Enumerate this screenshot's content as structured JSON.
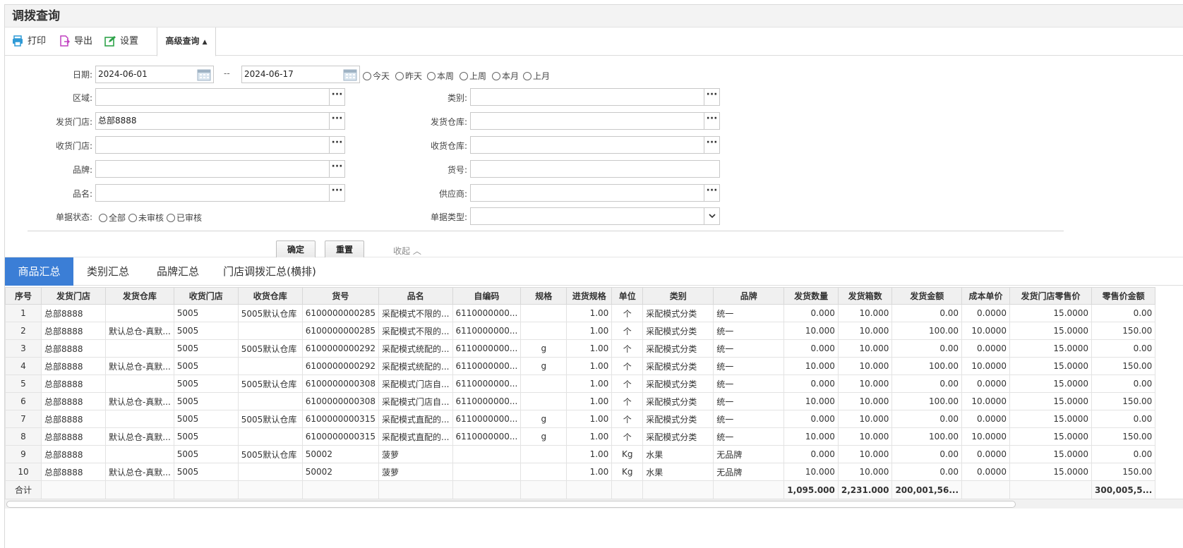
{
  "title": "调拨查询",
  "toolbar": {
    "print": "打印",
    "export": "导出",
    "settings": "设置",
    "advanced": "高级查询"
  },
  "query": {
    "date_label": "日期:",
    "date_from": "2024-06-01",
    "date_sep": "--",
    "date_to": "2024-06-17",
    "date_presets": [
      "今天",
      "昨天",
      "本周",
      "上周",
      "本月",
      "上月"
    ],
    "area_label": "区域:",
    "category_label": "类别:",
    "send_store_label": "发货门店:",
    "send_store_value": "总部8888",
    "send_wh_label": "发货仓库:",
    "recv_store_label": "收货门店:",
    "recv_wh_label": "收货仓库:",
    "brand_label": "品牌:",
    "item_no_label": "货号:",
    "name_label": "品名:",
    "supplier_label": "供应商:",
    "status_label": "单据状态:",
    "status_options": [
      "全部",
      "未审核",
      "已审核"
    ],
    "doc_type_label": "单据类型:",
    "confirm": "确定",
    "reset": "重置",
    "collapse": "收起"
  },
  "tabs": [
    "商品汇总",
    "类别汇总",
    "品牌汇总",
    "门店调拨汇总(横排)"
  ],
  "grid": {
    "headers": [
      "序号",
      "发货门店",
      "发货仓库",
      "收货门店",
      "收货仓库",
      "货号",
      "品名",
      "自编码",
      "规格",
      "进货规格",
      "单位",
      "类别",
      "品牌",
      "发货数量",
      "发货箱数",
      "发货金额",
      "成本单价",
      "发货门店零售价",
      "零售价金额"
    ],
    "rows": [
      [
        "1",
        "总部8888",
        "",
        "5005",
        "5005默认仓库",
        "6100000000285",
        "采配模式不限的...",
        "6110000000...",
        "",
        "1.00",
        "个",
        "采配模式分类",
        "统一",
        "0.000",
        "10.000",
        "0.00",
        "0.0000",
        "15.0000",
        "0.00"
      ],
      [
        "2",
        "总部8888",
        "默认总仓-真默...",
        "5005",
        "",
        "6100000000285",
        "采配模式不限的...",
        "6110000000...",
        "",
        "1.00",
        "个",
        "采配模式分类",
        "统一",
        "10.000",
        "10.000",
        "100.00",
        "10.0000",
        "15.0000",
        "150.00"
      ],
      [
        "3",
        "总部8888",
        "",
        "5005",
        "5005默认仓库",
        "6100000000292",
        "采配模式统配的...",
        "6110000000...",
        "g",
        "1.00",
        "个",
        "采配模式分类",
        "统一",
        "0.000",
        "10.000",
        "0.00",
        "0.0000",
        "15.0000",
        "0.00"
      ],
      [
        "4",
        "总部8888",
        "默认总仓-真默...",
        "5005",
        "",
        "6100000000292",
        "采配模式统配的...",
        "6110000000...",
        "g",
        "1.00",
        "个",
        "采配模式分类",
        "统一",
        "10.000",
        "10.000",
        "100.00",
        "10.0000",
        "15.0000",
        "150.00"
      ],
      [
        "5",
        "总部8888",
        "",
        "5005",
        "5005默认仓库",
        "6100000000308",
        "采配模式门店自...",
        "6110000000...",
        "",
        "1.00",
        "个",
        "采配模式分类",
        "统一",
        "0.000",
        "10.000",
        "0.00",
        "0.0000",
        "15.0000",
        "0.00"
      ],
      [
        "6",
        "总部8888",
        "默认总仓-真默...",
        "5005",
        "",
        "6100000000308",
        "采配模式门店自...",
        "6110000000...",
        "",
        "1.00",
        "个",
        "采配模式分类",
        "统一",
        "10.000",
        "10.000",
        "100.00",
        "10.0000",
        "15.0000",
        "150.00"
      ],
      [
        "7",
        "总部8888",
        "",
        "5005",
        "5005默认仓库",
        "6100000000315",
        "采配模式直配的...",
        "6110000000...",
        "g",
        "1.00",
        "个",
        "采配模式分类",
        "统一",
        "0.000",
        "10.000",
        "0.00",
        "0.0000",
        "15.0000",
        "0.00"
      ],
      [
        "8",
        "总部8888",
        "默认总仓-真默...",
        "5005",
        "",
        "6100000000315",
        "采配模式直配的...",
        "6110000000...",
        "g",
        "1.00",
        "个",
        "采配模式分类",
        "统一",
        "10.000",
        "10.000",
        "100.00",
        "10.0000",
        "15.0000",
        "150.00"
      ],
      [
        "9",
        "总部8888",
        "",
        "5005",
        "5005默认仓库",
        "50002",
        "菠萝",
        "",
        "",
        "1.00",
        "Kg",
        "水果",
        "无品牌",
        "0.000",
        "10.000",
        "0.00",
        "0.0000",
        "15.0000",
        "0.00"
      ],
      [
        "10",
        "总部8888",
        "默认总仓-真默...",
        "5005",
        "",
        "50002",
        "菠萝",
        "",
        "",
        "1.00",
        "Kg",
        "水果",
        "无品牌",
        "10.000",
        "10.000",
        "0.00",
        "0.0000",
        "15.0000",
        "150.00"
      ]
    ],
    "totals": {
      "label": "合计",
      "qty": "1,095.000",
      "boxes": "2,231.000",
      "amount": "200,001,56...",
      "retail_amount": "300,005,5..."
    }
  }
}
